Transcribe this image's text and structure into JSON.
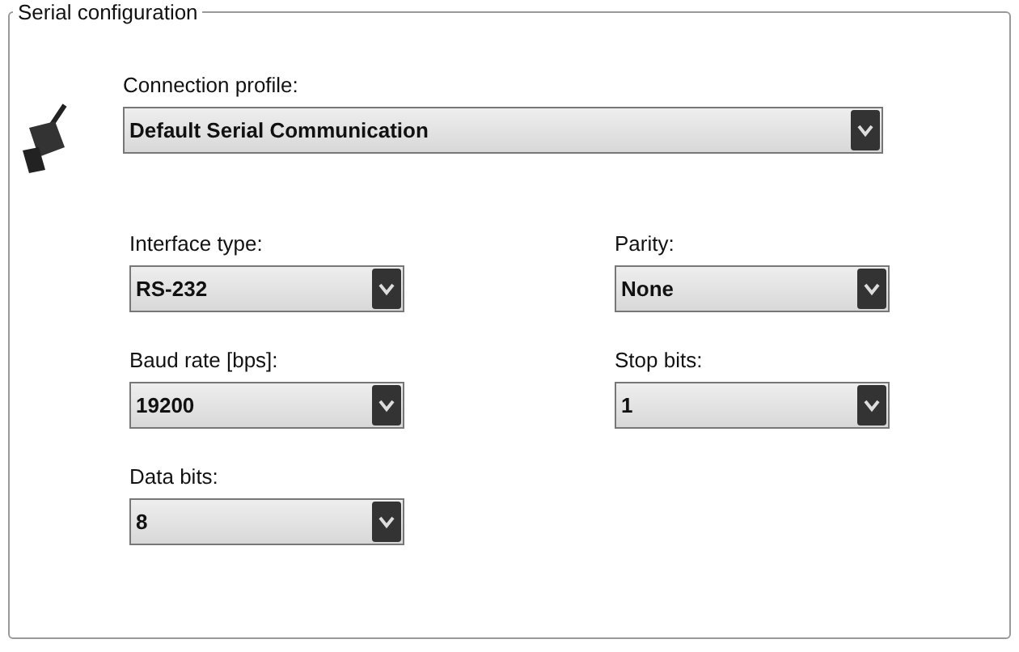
{
  "group": {
    "title": "Serial configuration"
  },
  "connection_profile": {
    "label": "Connection profile:",
    "value": "Default Serial Communication"
  },
  "fields": [
    {
      "label": "Interface type:",
      "value": "RS-232"
    },
    {
      "label": "Parity:",
      "value": "None"
    },
    {
      "label": "Baud rate [bps]:",
      "value": "19200"
    },
    {
      "label": "Stop bits:",
      "value": "1"
    },
    {
      "label": "Data bits:",
      "value": "8"
    }
  ]
}
